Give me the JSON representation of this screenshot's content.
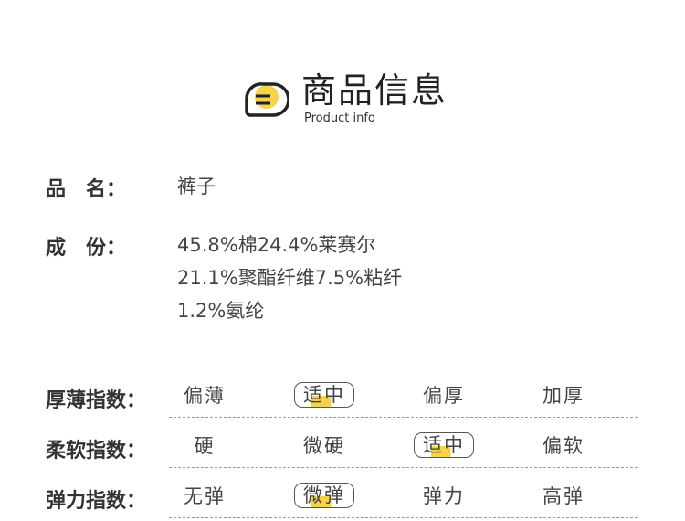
{
  "header": {
    "title": "商品信息",
    "subtitle": "Product info",
    "accent": "#f6d44a"
  },
  "product": {
    "name_label": "品　名：",
    "name_value": "裤子",
    "composition_label": "成　份：",
    "composition_lines": [
      "45.8%棉24.4%莱赛尔",
      "21.1%聚酯纤维7.5%粘纤",
      "1.2%氨纶"
    ]
  },
  "ratings": [
    {
      "label": "厚薄指数：",
      "options": [
        "偏薄",
        "适中",
        "偏厚",
        "加厚"
      ],
      "selected": 1
    },
    {
      "label": "柔软指数：",
      "options": [
        "硬",
        "微硬",
        "适中",
        "偏软"
      ],
      "selected": 2
    },
    {
      "label": "弹力指数：",
      "options": [
        "无弹",
        "微弹",
        "弹力",
        "高弹"
      ],
      "selected": 1
    }
  ]
}
